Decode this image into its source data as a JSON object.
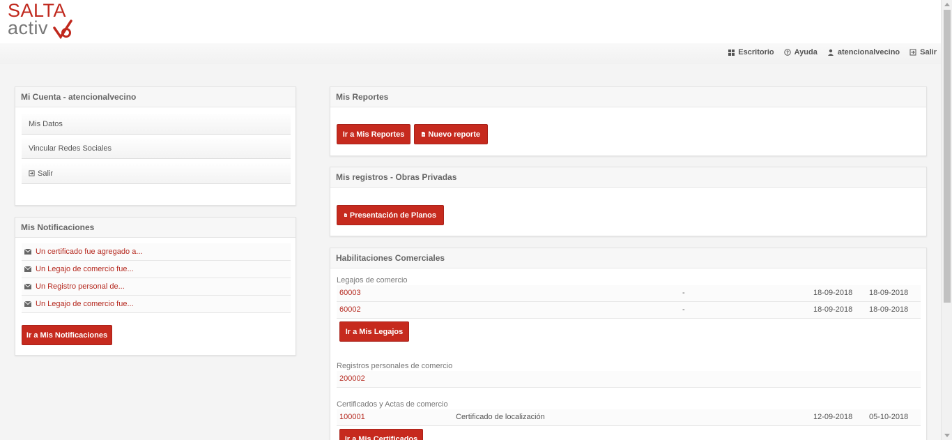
{
  "logo": {
    "line1": "SALTA",
    "line2": "activ",
    "letter_a": "a"
  },
  "nav": {
    "escritorio": "Escritorio",
    "ayuda": "Ayuda",
    "user": "atencionalvecino",
    "salir": "Salir"
  },
  "cuenta": {
    "title": "Mi Cuenta - atencionalvecino",
    "items": [
      "Mis Datos",
      "Vincular Redes Sociales",
      "Salir"
    ]
  },
  "notificaciones": {
    "title": "Mis Notificaciones",
    "items": [
      "Un certificado fue agregado a...",
      "Un Legajo de comercio fue...",
      "Un Registro personal de...",
      "Un Legajo de comercio fue..."
    ],
    "button": "Ir a Mis Notificaciones"
  },
  "reportes": {
    "title": "Mis Reportes",
    "btn_ir": "Ir a Mis Reportes",
    "btn_nuevo": "Nuevo reporte"
  },
  "registros": {
    "title": "Mis registros - Obras Privadas",
    "btn": "Presentación de Planos"
  },
  "habilitaciones": {
    "title": "Habilitaciones Comerciales",
    "legajos_label": "Legajos de comercio",
    "legajos": [
      {
        "id": "60003",
        "desc": "-",
        "date1": "18-09-2018",
        "date2": "18-09-2018"
      },
      {
        "id": "60002",
        "desc": "-",
        "date1": "18-09-2018",
        "date2": "18-09-2018"
      }
    ],
    "legajos_btn": "Ir a Mis Legajos",
    "registros_label": "Registros personales de comercio",
    "registros": [
      {
        "id": "200002"
      }
    ],
    "certificados_label": "Certificados y Actas de comercio",
    "certificados": [
      {
        "id": "100001",
        "desc": "Certificado de localización",
        "date1": "12-09-2018",
        "date2": "05-10-2018"
      }
    ],
    "certificados_btn": "Ir a Mis Certificados"
  },
  "colors": {
    "accent": "#c62a1e",
    "link": "#b5281e"
  }
}
